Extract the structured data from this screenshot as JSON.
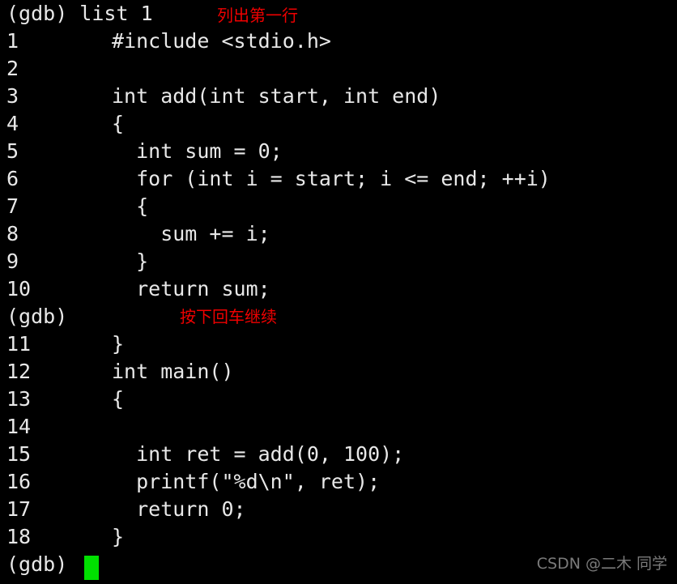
{
  "terminal": {
    "title": "gdb",
    "background_color": "#000000",
    "foreground_color": "#e8e8e8",
    "cursor_color": "#00e000",
    "annotation_color": "#ef0000",
    "watermark_color": "#7a7a7a"
  },
  "command_line": {
    "prompt": "(gdb)",
    "command": " list 1",
    "full": "(gdb) list 1"
  },
  "listing": [
    {
      "number": "1",
      "code": "#include <stdio.h>"
    },
    {
      "number": "2",
      "code": ""
    },
    {
      "number": "3",
      "code": "int add(int start, int end)"
    },
    {
      "number": "4",
      "code": "{"
    },
    {
      "number": "5",
      "code": "  int sum = 0;"
    },
    {
      "number": "6",
      "code": "  for (int i = start; i <= end; ++i)"
    },
    {
      "number": "7",
      "code": "  {"
    },
    {
      "number": "8",
      "code": "    sum += i;"
    },
    {
      "number": "9",
      "code": "  }"
    },
    {
      "number": "10",
      "code": "  return sum;"
    }
  ],
  "middle_prompt": {
    "prompt": "(gdb)"
  },
  "listing2": [
    {
      "number": "11",
      "code": "}"
    },
    {
      "number": "12",
      "code": "int main()"
    },
    {
      "number": "13",
      "code": "{"
    },
    {
      "number": "14",
      "code": ""
    },
    {
      "number": "15",
      "code": "  int ret = add(0, 100);"
    },
    {
      "number": "16",
      "code": "  printf(\"%d\\n\", ret);"
    },
    {
      "number": "17",
      "code": "  return 0;"
    },
    {
      "number": "18",
      "code": "}"
    }
  ],
  "final_prompt": {
    "prompt": "(gdb)"
  },
  "annotations": {
    "list_first_line": "列出第一行",
    "press_enter": "按下回车继续"
  },
  "watermark": {
    "text": "CSDN @二木 同学"
  }
}
